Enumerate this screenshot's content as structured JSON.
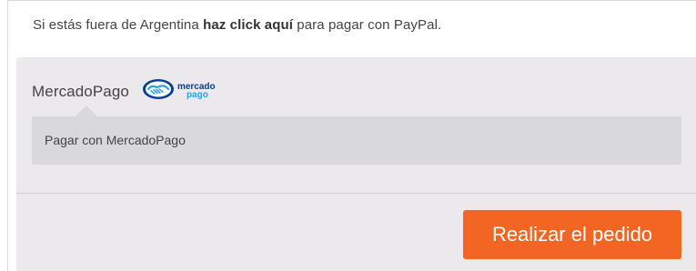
{
  "notice": {
    "prefix": "Si estás fuera de Argentina ",
    "link": "haz click aquí",
    "suffix": " para pagar con PayPal."
  },
  "payment": {
    "method_label": "MercadoPago",
    "logo": {
      "icon": "handshake-icon",
      "line1": "mercado",
      "line2": "pago",
      "colors": {
        "navy": "#0a3d91",
        "blue": "#27a4e0"
      }
    },
    "description": "Pagar con MercadoPago"
  },
  "order": {
    "button_label": "Realizar el pedido",
    "button_color": "#f26522"
  }
}
